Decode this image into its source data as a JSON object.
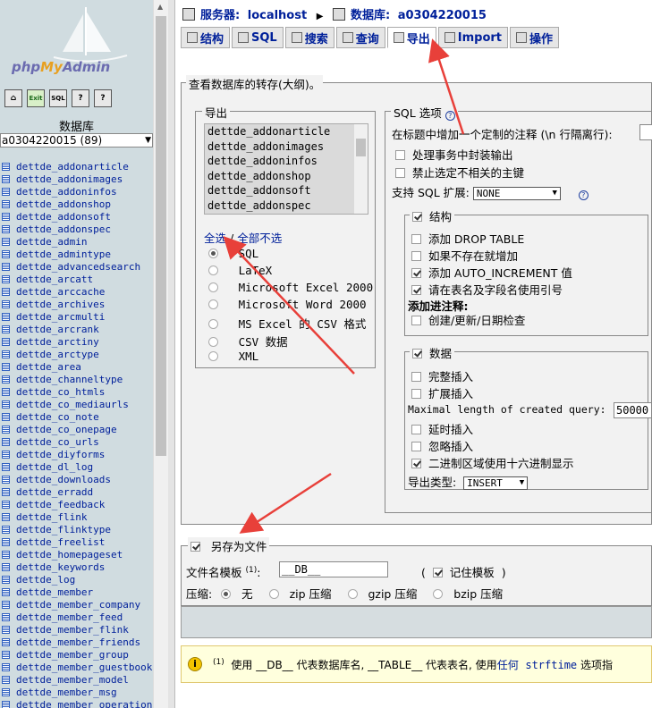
{
  "sidebar": {
    "logo": "phpMyAdmin",
    "logo_a": "php",
    "logo_b": "My",
    "logo_c": "Admin",
    "toolbar": [
      "home-icon",
      "exit-icon",
      "sql-icon",
      "query-icon",
      "docs-icon"
    ],
    "toolbar_labels": [
      "⌂",
      "Exit",
      "SQL",
      "?",
      "?"
    ],
    "db_label": "数据库",
    "db_selected": "a0304220015 (89)",
    "tables": [
      "dettde_addonarticle",
      "dettde_addonimages",
      "dettde_addoninfos",
      "dettde_addonshop",
      "dettde_addonsoft",
      "dettde_addonspec",
      "dettde_admin",
      "dettde_admintype",
      "dettde_advancedsearch",
      "dettde_arcatt",
      "dettde_arccache",
      "dettde_archives",
      "dettde_arcmulti",
      "dettde_arcrank",
      "dettde_arctiny",
      "dettde_arctype",
      "dettde_area",
      "dettde_channeltype",
      "dettde_co_htmls",
      "dettde_co_mediaurls",
      "dettde_co_note",
      "dettde_co_onepage",
      "dettde_co_urls",
      "dettde_diyforms",
      "dettde_dl_log",
      "dettde_downloads",
      "dettde_erradd",
      "dettde_feedback",
      "dettde_flink",
      "dettde_flinktype",
      "dettde_freelist",
      "dettde_homepageset",
      "dettde_keywords",
      "dettde_log",
      "dettde_member",
      "dettde_member_company",
      "dettde_member_feed",
      "dettde_member_flink",
      "dettde_member_friends",
      "dettde_member_group",
      "dettde_member_guestbook",
      "dettde_member_model",
      "dettde_member_msg",
      "dettde_member_operation"
    ]
  },
  "header": {
    "server_label": "服务器:",
    "server": "localhost",
    "db_label": "数据库:",
    "db": "a0304220015"
  },
  "tabs": [
    {
      "label": "结构",
      "icon": "structure-icon"
    },
    {
      "label": "SQL",
      "icon": "sql-icon"
    },
    {
      "label": "搜索",
      "icon": "search-icon"
    },
    {
      "label": "查询",
      "icon": "query-icon"
    },
    {
      "label": "导出",
      "icon": "export-icon",
      "active": true
    },
    {
      "label": "Import",
      "icon": "import-icon"
    },
    {
      "label": "操作",
      "icon": "operations-icon"
    }
  ],
  "main": {
    "legend": "查看数据库的转存(大纲)。",
    "export": {
      "legend": "导出",
      "tables": [
        "dettde_addonarticle",
        "dettde_addonimages",
        "dettde_addoninfos",
        "dettde_addonshop",
        "dettde_addonsoft",
        "dettde_addonspec"
      ],
      "select_all": "全选",
      "separator": "/",
      "select_none": "全部不选",
      "formats": [
        {
          "label": "SQL",
          "checked": true
        },
        {
          "label": "LaTeX",
          "checked": false
        },
        {
          "label": "Microsoft Excel 2000",
          "checked": false
        },
        {
          "label": "Microsoft Word 2000",
          "checked": false
        },
        {
          "label": "MS Excel 的 CSV 格式",
          "checked": false
        },
        {
          "label": "CSV 数据",
          "checked": false
        },
        {
          "label": "XML",
          "checked": false
        }
      ]
    },
    "sql": {
      "legend": "SQL 选项",
      "comment_label": "在标题中增加一个定制的注释 (\\n 行隔离行):",
      "opt_transaction": "处理事务中封装输出",
      "opt_foreign": "禁止选定不相关的主键",
      "compat_label": "支持 SQL 扩展:",
      "compat_value": "NONE",
      "structure": {
        "legend": "结构",
        "drop_table": "添加 DROP TABLE",
        "if_not_exists": "如果不存在就增加",
        "auto_increment": "添加 AUTO_INCREMENT 值",
        "backquotes": "请在表名及字段名使用引号",
        "comments_label": "添加进注释:",
        "dates": "创建/更新/日期检查"
      },
      "data": {
        "legend": "数据",
        "complete_insert": "完整插入",
        "extended_insert": "扩展插入",
        "max_query_label": "Maximal length of created query:",
        "max_query_value": "50000",
        "delayed": "延时插入",
        "ignore": "忽略插入",
        "hex": "二进制区域使用十六进制显示",
        "type_label": "导出类型:",
        "type_value": "INSERT"
      }
    },
    "save": {
      "legend": "另存为文件",
      "filename_label": "文件名模板",
      "footnote_ref": "(1)",
      "filename_value": "__DB__",
      "paren_open": "(",
      "remember": "记住模板",
      "paren_close": ")",
      "compress_label": "压缩:",
      "compressions": [
        {
          "label": "无",
          "checked": true
        },
        {
          "label": "zip 压缩",
          "checked": false
        },
        {
          "label": "gzip 压缩",
          "checked": false
        },
        {
          "label": "bzip 压缩",
          "checked": false
        }
      ]
    },
    "note": {
      "marker": "(1)",
      "text_a": "使用 __DB__ 代表数据库名, __TABLE__ 代表表名, 使用",
      "link_a": "任何",
      "link_b": "strftime",
      "text_b": "选项指"
    }
  },
  "colors": {
    "link": "#00209a",
    "arrow": "#e8403a",
    "panel": "#f2f2f2",
    "sidebar": "#d0dce0",
    "note_bg": "#ffffdd"
  }
}
